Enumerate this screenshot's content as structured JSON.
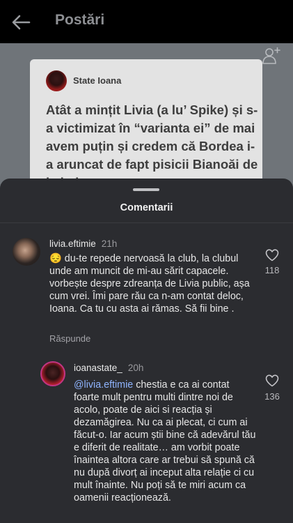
{
  "appbar": {
    "title": "Postări"
  },
  "post": {
    "author": "State Ioana",
    "text": "Atât a mințit Livia (a lu’ Spike) și s-a victimizat în “varianta ei” de mai avem puțin și credem că Bordea i-a aruncat de fapt pisicii Bianoăi de la balcon"
  },
  "sheet": {
    "title": "Comentarii"
  },
  "comments": [
    {
      "user": "livia.eftimie",
      "time": "21h",
      "text": "😔 du-te repede nervoasă la club, la clubul unde am muncit de mi-au sărit capacele. vorbește despre zdreanța de Livia public, așa cum vrei. Îmi pare rău ca n-am contat deloc, Ioana. Ca tu cu asta ai rămas. Să fii bine .",
      "reply_label": "Răspunde",
      "likes": "118"
    },
    {
      "user": "ioanastate_",
      "time": "20h",
      "mention": "@livia.eftimie",
      "text": " chestia e ca ai contat foarte mult pentru multi dintre noi de acolo, poate de aici si reacția și dezamăgirea. Nu ca ai plecat, ci cum ai făcut-o. Iar acum știi bine că adevărul tău e diferit de realitate… am vorbit poate înaintea altora care ar trebui să spună că nu după divorț ai inceput alta relație ci cu mult înainte. Nu poți să te miri acum ca oamenii reacționează.",
      "likes": "136"
    }
  ]
}
